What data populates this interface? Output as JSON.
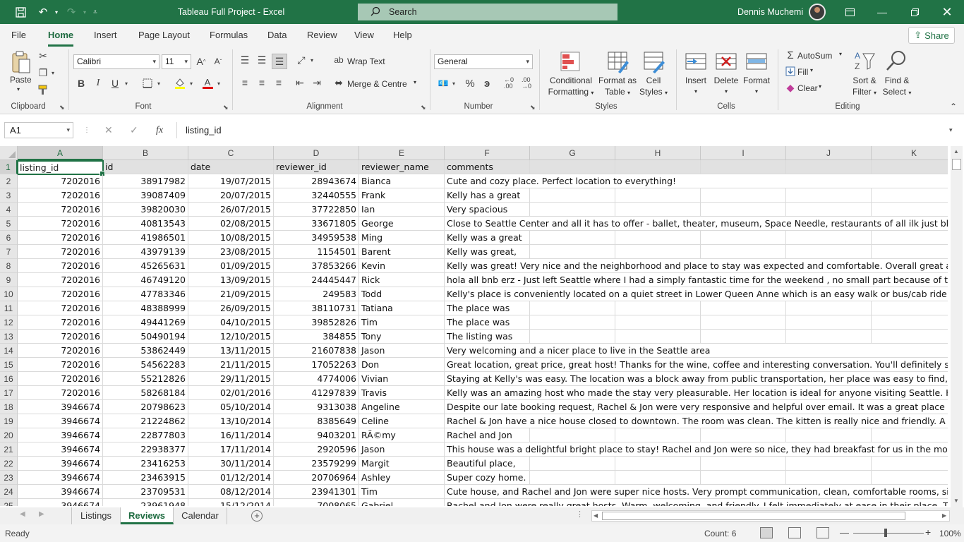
{
  "titlebar": {
    "title": "Tableau Full Project  -  Excel",
    "search_placeholder": "Search",
    "user_name": "Dennis Muchemi"
  },
  "menu": {
    "tabs": [
      "File",
      "Home",
      "Insert",
      "Page Layout",
      "Formulas",
      "Data",
      "Review",
      "View",
      "Help"
    ],
    "active": "Home",
    "share_label": "Share"
  },
  "ribbon": {
    "clipboard": {
      "paste": "Paste",
      "label": "Clipboard"
    },
    "font": {
      "name": "Calibri",
      "size": "11",
      "label": "Font"
    },
    "alignment": {
      "wrap_text": "Wrap Text",
      "merge": "Merge & Centre",
      "label": "Alignment"
    },
    "number": {
      "format": "General",
      "label": "Number"
    },
    "styles": {
      "conditional_1": "Conditional",
      "conditional_2": "Formatting",
      "format_table_1": "Format as",
      "format_table_2": "Table",
      "cell_styles_1": "Cell",
      "cell_styles_2": "Styles",
      "label": "Styles"
    },
    "cells": {
      "insert": "Insert",
      "delete": "Delete",
      "format": "Format",
      "label": "Cells"
    },
    "editing": {
      "autosum": "AutoSum",
      "fill": "Fill",
      "clear": "Clear",
      "sort_1": "Sort &",
      "sort_2": "Filter",
      "find_1": "Find &",
      "find_2": "Select",
      "label": "Editing"
    }
  },
  "formula_bar": {
    "name_box": "A1",
    "formula": "listing_id"
  },
  "columns": [
    "A",
    "B",
    "C",
    "D",
    "E",
    "F",
    "G",
    "H",
    "I",
    "J",
    "K"
  ],
  "header_row": [
    "listing_id",
    "id",
    "date",
    "reviewer_id",
    "reviewer_name",
    "comments"
  ],
  "rows": [
    [
      "2",
      "7202016",
      "38917982",
      "19/07/2015",
      "28943674",
      "Bianca",
      "Cute and cozy place. Perfect location to everything!"
    ],
    [
      "3",
      "7202016",
      "39087409",
      "20/07/2015",
      "32440555",
      "Frank",
      "Kelly has a great"
    ],
    [
      "4",
      "7202016",
      "39820030",
      "26/07/2015",
      "37722850",
      "Ian",
      "Very spacious"
    ],
    [
      "5",
      "7202016",
      "40813543",
      "02/08/2015",
      "33671805",
      "George",
      "Close to Seattle Center and all it has to offer - ballet, theater, museum, Space Needle, restaurants of all ilk just block"
    ],
    [
      "6",
      "7202016",
      "41986501",
      "10/08/2015",
      "34959538",
      "Ming",
      "Kelly was a great"
    ],
    [
      "7",
      "7202016",
      "43979139",
      "23/08/2015",
      "1154501",
      "Barent",
      "Kelly was great,"
    ],
    [
      "8",
      "7202016",
      "45265631",
      "01/09/2015",
      "37853266",
      "Kevin",
      "Kelly was great! Very nice and the neighborhood and place to stay was expected and comfortable. Overall great and"
    ],
    [
      "9",
      "7202016",
      "46749120",
      "13/09/2015",
      "24445447",
      "Rick",
      "hola all bnb erz - Just left Seattle where I had a simply fantastic time for the weekend , no small part because of the"
    ],
    [
      "10",
      "7202016",
      "47783346",
      "21/09/2015",
      "249583",
      "Todd",
      "Kelly's place is conveniently located on a quiet street in Lower Queen Anne which is an easy walk or bus/cab ride to"
    ],
    [
      "11",
      "7202016",
      "48388999",
      "26/09/2015",
      "38110731",
      "Tatiana",
      "The place was"
    ],
    [
      "12",
      "7202016",
      "49441269",
      "04/10/2015",
      "39852826",
      "Tim",
      "The place was"
    ],
    [
      "13",
      "7202016",
      "50490194",
      "12/10/2015",
      "384855",
      "Tony",
      "The listing was"
    ],
    [
      "14",
      "7202016",
      "53862449",
      "13/11/2015",
      "21607838",
      "Jason",
      "Very welcoming and a nicer place to live in the Seattle area"
    ],
    [
      "15",
      "7202016",
      "54562283",
      "21/11/2015",
      "17052263",
      "Don",
      "Great location, great price, great host! Thanks for the wine, coffee and interesting conversation. You'll definitely see"
    ],
    [
      "16",
      "7202016",
      "55212826",
      "29/11/2015",
      "4774006",
      "Vivian",
      "Staying at Kelly's was easy. The location was a block away from public transportation, her place was easy to find, key"
    ],
    [
      "17",
      "7202016",
      "58268184",
      "02/01/2016",
      "41297839",
      "Travis",
      "Kelly was an amazing host who made the stay very pleasurable. Her location is ideal for anyone visiting Seattle. High"
    ],
    [
      "18",
      "3946674",
      "20798623",
      "05/10/2014",
      "9313038",
      "Angeline",
      "Despite our late booking request, Rachel & Jon were very responsive and helpful over email. It was a great place to"
    ],
    [
      "19",
      "3946674",
      "21224862",
      "13/10/2014",
      "8385649",
      "Celine",
      "Rachel & Jon have a nice house closed to downtown. The room was clean. The kitten is really nice and friendly. A go"
    ],
    [
      "20",
      "3946674",
      "22877803",
      "16/11/2014",
      "9403201",
      "RÃ©my",
      "Rachel and Jon"
    ],
    [
      "21",
      "3946674",
      "22938377",
      "17/11/2014",
      "2920596",
      "Jason",
      "This house was a delightful bright place to stay! Rachel and Jon were so nice, they had breakfast for us in the mornin"
    ],
    [
      "22",
      "3946674",
      "23416253",
      "30/11/2014",
      "23579299",
      "Margit",
      "Beautiful place,"
    ],
    [
      "23",
      "3946674",
      "23463915",
      "01/12/2014",
      "20706964",
      "Ashley",
      "Super cozy home."
    ],
    [
      "24",
      "3946674",
      "23709531",
      "08/12/2014",
      "23941301",
      "Tim",
      "Cute house, and Rachel and Jon were super nice hosts.  Very prompt communication, clean, comfortable rooms, sim"
    ],
    [
      "25",
      "3946674",
      "23961948",
      "15/12/2014",
      "7008065",
      "Gabriel",
      "Rachel and Jon were really great hosts. Warm, welcoming, and friendly. I felt immediately at ease in their place. The"
    ]
  ],
  "sheets": [
    "Listings",
    "Reviews",
    "Calendar"
  ],
  "active_sheet": "Reviews",
  "status": {
    "ready": "Ready",
    "count": "Count: 6",
    "zoom": "100%"
  },
  "colors": {
    "accent": "#217346",
    "title_bar": "#217346"
  }
}
